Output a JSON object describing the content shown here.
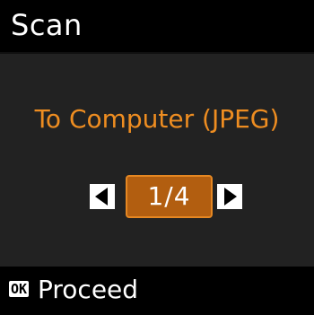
{
  "header": {
    "title": "Scan"
  },
  "main": {
    "mode_label": "To Computer (JPEG)",
    "pager": {
      "page_text": "1/4",
      "left_icon": "triangle-left-icon",
      "right_icon": "triangle-right-icon"
    }
  },
  "footer": {
    "ok_label": "OK",
    "action_label": "Proceed"
  },
  "colors": {
    "accent": "#ee8d21",
    "page_box_fill": "#b25e10",
    "background_main": "#222222",
    "background_bars": "#000000"
  }
}
